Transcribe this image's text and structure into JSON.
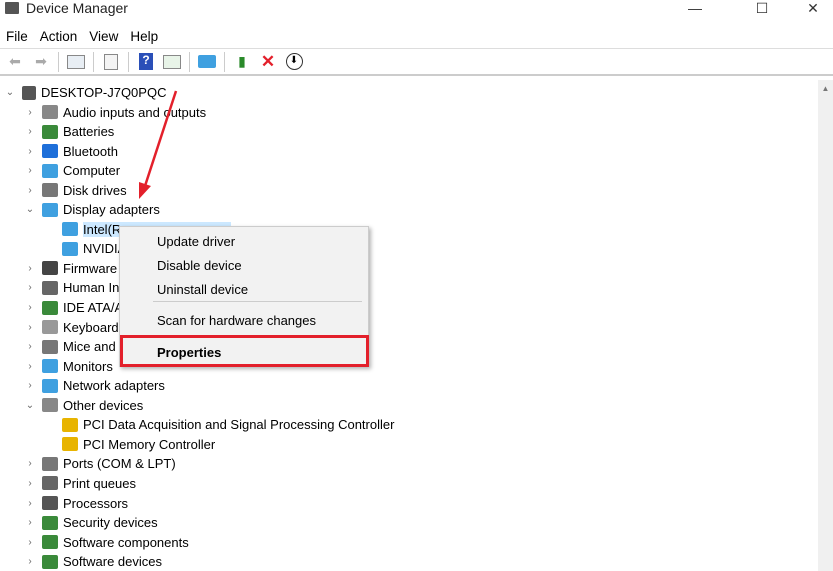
{
  "window": {
    "title": "Device Manager",
    "minimize": "—",
    "maximize": "☐",
    "close": "✕"
  },
  "menubar": [
    "File",
    "Action",
    "View",
    "Help"
  ],
  "tree": {
    "root": "DESKTOP-J7Q0PQC",
    "items": [
      {
        "label": "Audio inputs and outputs",
        "level": 1,
        "state": "collapsed",
        "icon": "#888"
      },
      {
        "label": "Batteries",
        "level": 1,
        "state": "collapsed",
        "icon": "#3a8a3a"
      },
      {
        "label": "Bluetooth",
        "level": 1,
        "state": "collapsed",
        "icon": "#1e6fd9"
      },
      {
        "label": "Computer",
        "level": 1,
        "state": "collapsed",
        "icon": "#3fa0e0"
      },
      {
        "label": "Disk drives",
        "level": 1,
        "state": "collapsed",
        "icon": "#777"
      },
      {
        "label": "Display adapters",
        "level": 1,
        "state": "expanded",
        "icon": "#3fa0e0"
      },
      {
        "label": "Intel(R",
        "level": 2,
        "state": "selected",
        "icon": "#3fa0e0"
      },
      {
        "label": "NVIDIA",
        "level": 2,
        "state": "leaf",
        "icon": "#3fa0e0"
      },
      {
        "label": "Firmware",
        "level": 1,
        "state": "collapsed",
        "icon": "#444"
      },
      {
        "label": "Human In",
        "level": 1,
        "state": "collapsed",
        "icon": "#666"
      },
      {
        "label": "IDE ATA/AT",
        "level": 1,
        "state": "collapsed",
        "icon": "#3a8a3a"
      },
      {
        "label": "Keyboard",
        "level": 1,
        "state": "collapsed",
        "icon": "#999"
      },
      {
        "label": "Mice and",
        "level": 1,
        "state": "collapsed",
        "icon": "#777"
      },
      {
        "label": "Monitors",
        "level": 1,
        "state": "collapsed",
        "icon": "#3fa0e0"
      },
      {
        "label": "Network adapters",
        "level": 1,
        "state": "collapsed",
        "icon": "#3fa0e0"
      },
      {
        "label": "Other devices",
        "level": 1,
        "state": "expanded",
        "icon": "#888"
      },
      {
        "label": "PCI Data Acquisition and Signal Processing Controller",
        "level": 2,
        "state": "warning",
        "icon": "#e8b400"
      },
      {
        "label": "PCI Memory Controller",
        "level": 2,
        "state": "warning",
        "icon": "#e8b400"
      },
      {
        "label": "Ports (COM & LPT)",
        "level": 1,
        "state": "collapsed",
        "icon": "#777"
      },
      {
        "label": "Print queues",
        "level": 1,
        "state": "collapsed",
        "icon": "#666"
      },
      {
        "label": "Processors",
        "level": 1,
        "state": "collapsed",
        "icon": "#555"
      },
      {
        "label": "Security devices",
        "level": 1,
        "state": "collapsed",
        "icon": "#3a8a3a"
      },
      {
        "label": "Software components",
        "level": 1,
        "state": "collapsed",
        "icon": "#3a8a3a"
      },
      {
        "label": "Software devices",
        "level": 1,
        "state": "collapsed",
        "icon": "#3a8a3a"
      }
    ]
  },
  "context_menu": {
    "items": [
      "Update driver",
      "Disable device",
      "Uninstall device",
      "Scan for hardware changes",
      "Properties"
    ]
  },
  "colors": {
    "highlight": "#e3202b",
    "arrow": "#e3202b",
    "selection": "#cce8ff"
  }
}
